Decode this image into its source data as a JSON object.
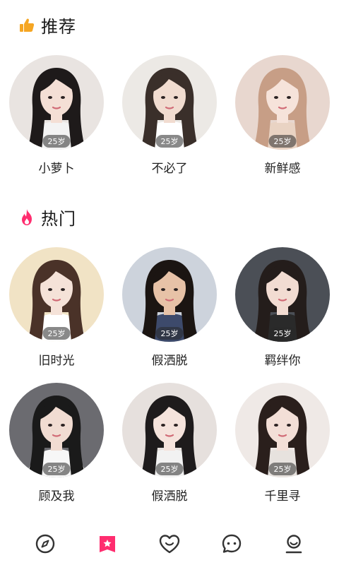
{
  "recommend": {
    "title": "推荐",
    "items": [
      {
        "name": "小萝卜",
        "age": "25岁",
        "bg": "#e9e4e1",
        "hair": "#1e1a1a",
        "skin": "#f4dfd5",
        "shirt": "#f3f3f3"
      },
      {
        "name": "不必了",
        "age": "25岁",
        "bg": "#ece9e5",
        "hair": "#3a2f2a",
        "skin": "#f1dcd0",
        "shirt": "#ffffff"
      },
      {
        "name": "新鲜感",
        "age": "25岁",
        "bg": "#e8d7cf",
        "hair": "#c79e86",
        "skin": "#f6e3da",
        "shirt": "#e9d3c3"
      }
    ]
  },
  "hot": {
    "title": "热门",
    "items": [
      {
        "name": "旧时光",
        "age": "25岁",
        "bg": "#f1e3c5",
        "hair": "#4a3228",
        "skin": "#f5e2d8",
        "shirt": "#ffffff"
      },
      {
        "name": "假洒脱",
        "age": "25岁",
        "bg": "#cdd3dc",
        "hair": "#1b1512",
        "skin": "#e7c2a7",
        "shirt": "#3d4a6b"
      },
      {
        "name": "羁绊你",
        "age": "25岁",
        "bg": "#4b4f56",
        "hair": "#241d1b",
        "skin": "#f2dcd2",
        "shirt": "#2a2a2a"
      },
      {
        "name": "顾及我",
        "age": "25岁",
        "bg": "#6b6b70",
        "hair": "#1a1a1a",
        "skin": "#f1dcd2",
        "shirt": "#f7f7f7"
      },
      {
        "name": "假洒脱",
        "age": "25岁",
        "bg": "#e6e0dd",
        "hair": "#1e1b1c",
        "skin": "#f5e3dc",
        "shirt": "#f2f2f2"
      },
      {
        "name": "千里寻",
        "age": "25岁",
        "bg": "#efe9e6",
        "hair": "#2a1f1c",
        "skin": "#f3dfd7",
        "shirt": "#e7e2de"
      }
    ]
  },
  "tabs": [
    {
      "icon": "compass-icon",
      "active": false
    },
    {
      "icon": "star-bookmark-icon",
      "active": true
    },
    {
      "icon": "heart-icon",
      "active": false
    },
    {
      "icon": "chat-bubble-icon",
      "active": false
    },
    {
      "icon": "profile-icon",
      "active": false
    }
  ],
  "colors": {
    "thumb": "#f5a623",
    "fire": "#ff2d6f",
    "active_tab": "#ff2d6f",
    "icon": "#333333"
  }
}
